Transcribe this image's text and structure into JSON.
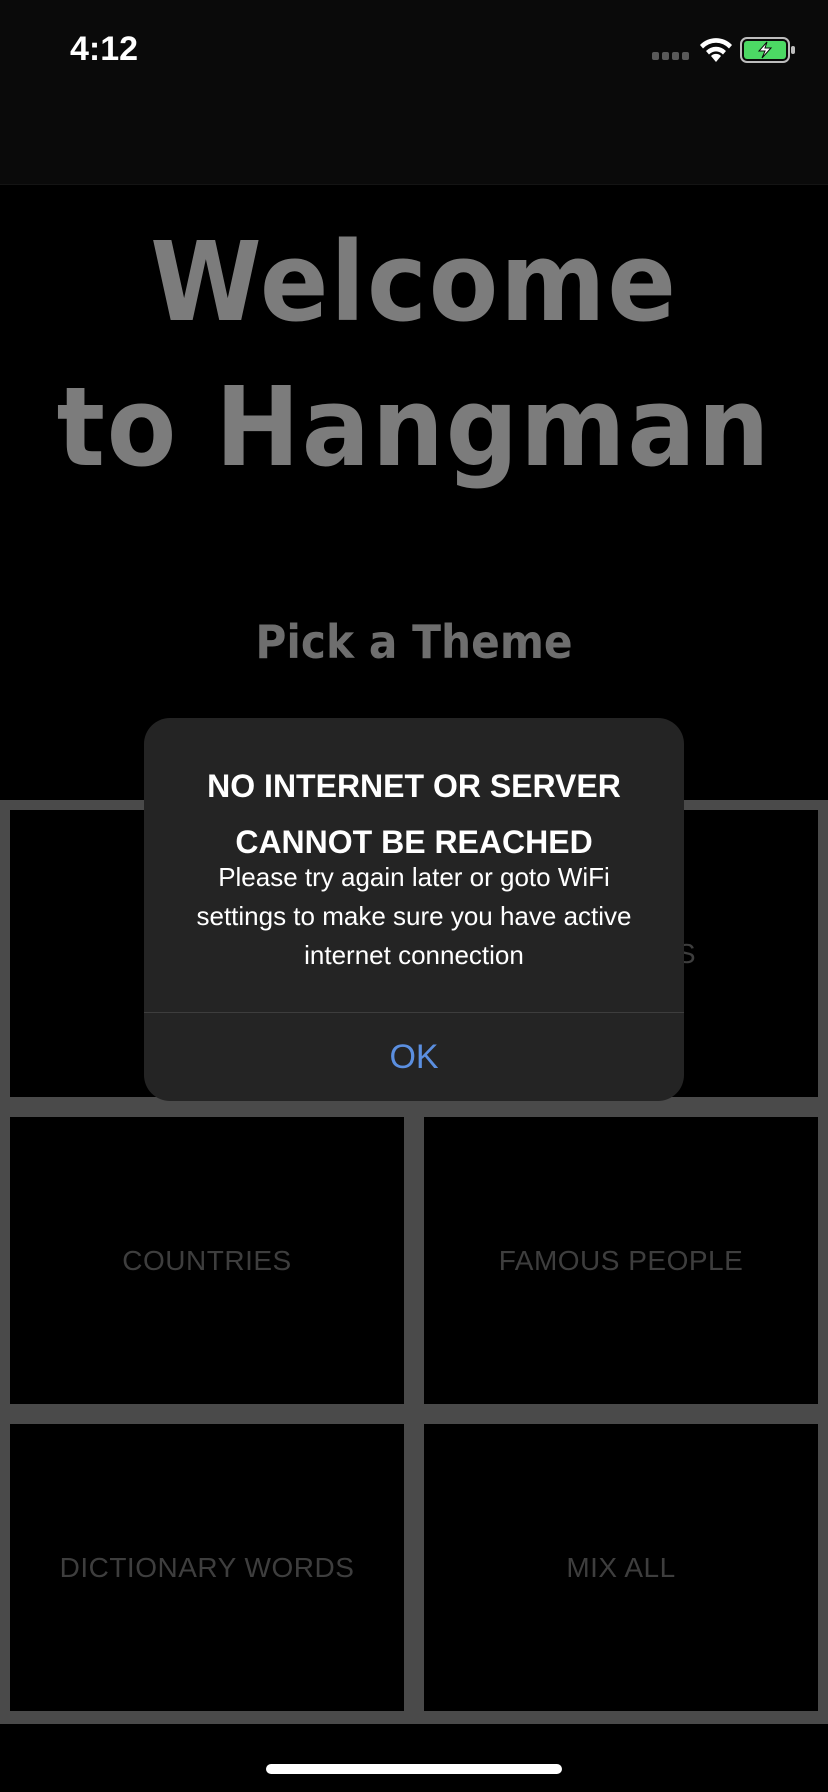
{
  "status_bar": {
    "time": "4:12"
  },
  "title": {
    "line1": "Welcome",
    "line2": "to Hangman"
  },
  "subtitle": "Pick a Theme",
  "themes": [
    {
      "label": ""
    },
    {
      "label": "S"
    },
    {
      "label": "COUNTRIES"
    },
    {
      "label": "FAMOUS PEOPLE"
    },
    {
      "label": "DICTIONARY WORDS"
    },
    {
      "label": "MIX ALL"
    }
  ],
  "alert": {
    "title": "NO INTERNET OR SERVER CANNOT BE REACHED",
    "message": "Please try again later or goto WiFi settings to make sure you have active internet connection",
    "ok_label": "OK"
  },
  "colors": {
    "accent": "#5b8fe0",
    "battery": "#4cd964"
  }
}
